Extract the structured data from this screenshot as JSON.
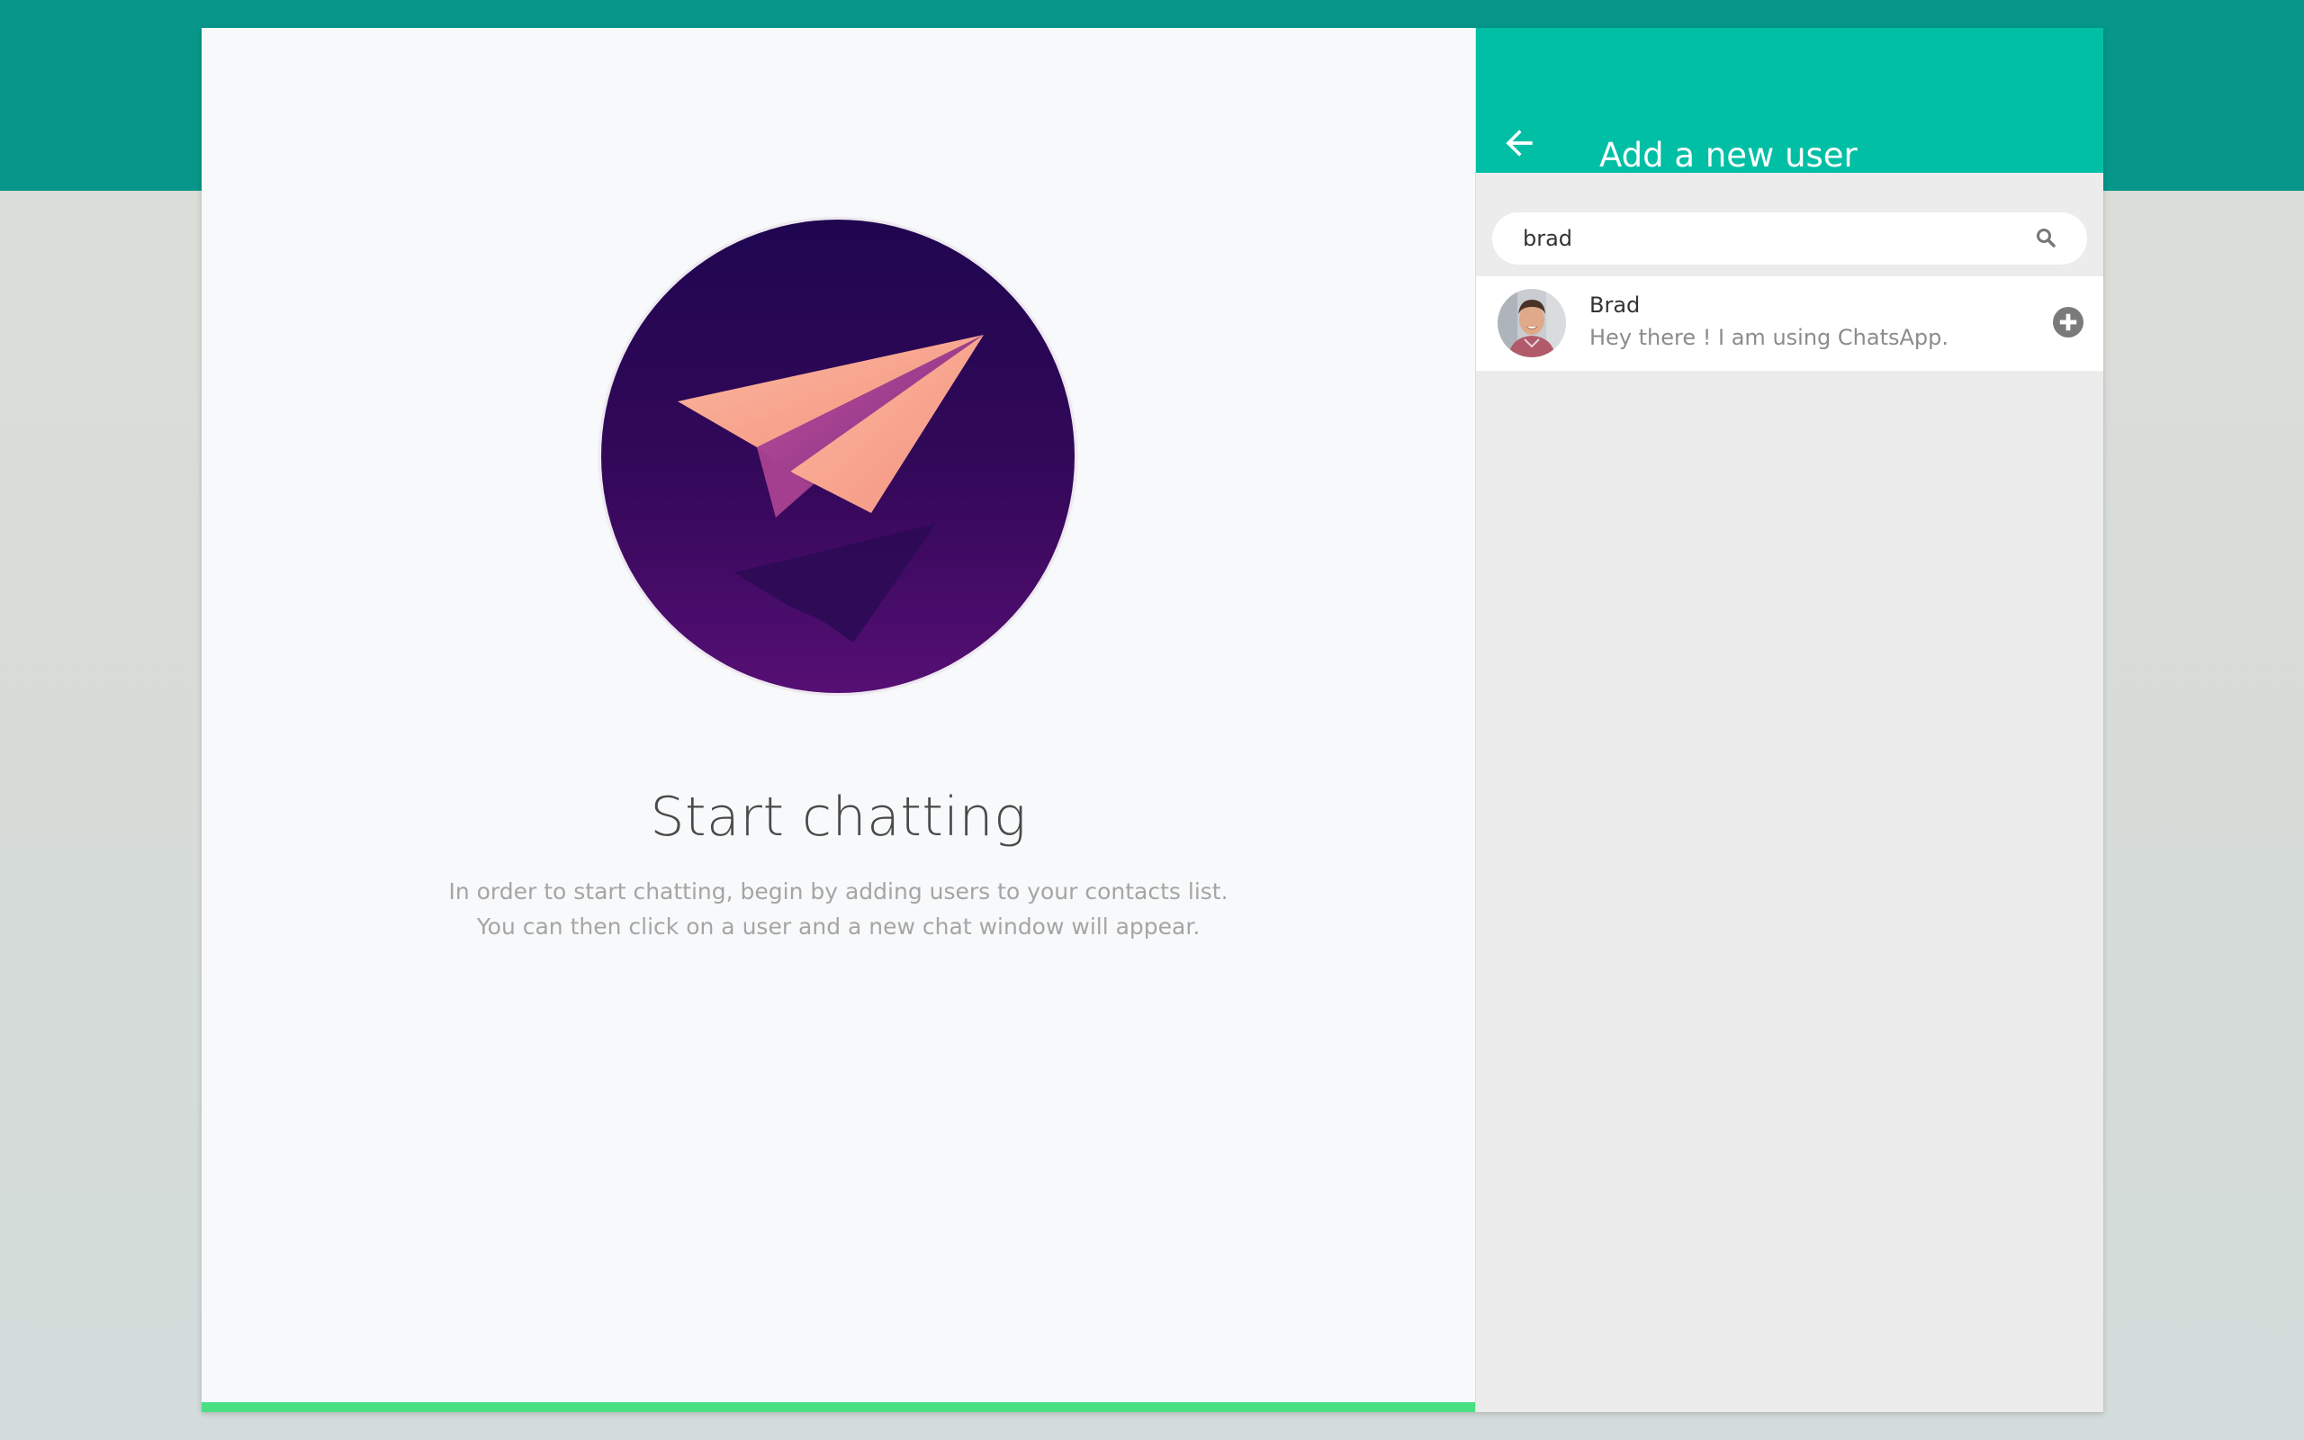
{
  "welcome": {
    "title": "Start chatting",
    "line1": "In order to start chatting, begin by adding users to your contacts list.",
    "line2": "You can then click on a user and a new chat window will appear."
  },
  "panel": {
    "title": "Add a new user",
    "back_icon": "arrow-left-icon",
    "search": {
      "value": "brad",
      "icon": "search-icon"
    },
    "results": [
      {
        "name": "Brad",
        "status": "Hey there ! I am using ChatsApp.",
        "action_icon": "plus-circle-icon"
      }
    ]
  },
  "colors": {
    "top_band": "#06978a",
    "panel_header": "#00bfa5",
    "bottom_accent": "#4adf83",
    "panel_bg": "#ececec",
    "welcome_bg": "#f8f9fa"
  }
}
